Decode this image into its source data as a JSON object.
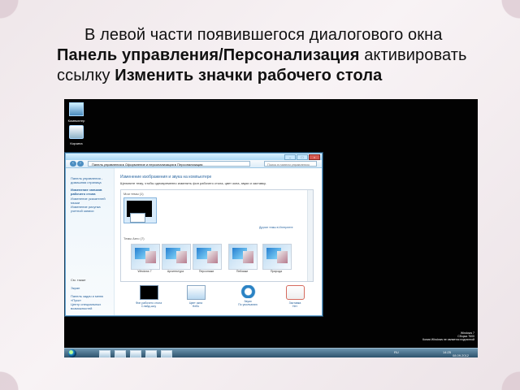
{
  "slide": {
    "text_before_1": "В левой части появившегося диалогового окна ",
    "bold_1": "Панель управления/Персонализация",
    "text_before_2": " активировать ссылку ",
    "bold_2": "Изменить значки рабочего стола"
  },
  "colors": {
    "background": "#f4edf0",
    "desktop": "#020202",
    "window_border": "#68a7d4",
    "link": "#245f99",
    "taskbar": "#284d67"
  },
  "desktop": {
    "icons": [
      {
        "label": "Компьютер",
        "icon": "computer-icon"
      },
      {
        "label": "Корзина",
        "icon": "recycle-bin-icon"
      }
    ]
  },
  "window": {
    "address": "Панель управления ▸ Оформление и персонализация ▸ Персонализация",
    "search_placeholder": "Поиск в панели управления",
    "controls": {
      "minimize": "–",
      "maximize": "□",
      "close": "×"
    },
    "sidebar": {
      "items": [
        "Панель управления - домашняя страница",
        "Изменение значков рабочего стола",
        "Изменение указателей мыши",
        "Изменение рисунка учетной записи"
      ],
      "see_also": "См. также",
      "bottom_items": [
        "Экран",
        "Панель задач и меню «Пуск»",
        "Центр специальных возможностей"
      ]
    },
    "main": {
      "title": "Изменение изображения и звука на компьютере",
      "subtitle": "Щелкните тему, чтобы одновременно изменить фон рабочего стола, цвет окна, звуки и заставку.",
      "my_themes": "Мои темы (1)",
      "aero_themes": "Темы Aero (7)",
      "online_link": "Другие темы в Интернете",
      "themes": [
        "Windows 7",
        "Архитектура",
        "Персонажи",
        "Пейзажи",
        "Природа"
      ],
      "tools": [
        {
          "label": "Фон рабочего стола",
          "value": "Слайд-шоу"
        },
        {
          "label": "Цвет окна",
          "value": "Небо"
        },
        {
          "label": "Звуки",
          "value": "По умолчанию"
        },
        {
          "label": "Заставка",
          "value": "Нет"
        }
      ]
    }
  },
  "taskbar": {
    "language": "RU",
    "time": "14:25",
    "date": "08.09.2012"
  },
  "watermark": {
    "line1": "Windows 7",
    "line2": "Сборка 7600",
    "line3": "Копия Windows не является подлинной"
  }
}
